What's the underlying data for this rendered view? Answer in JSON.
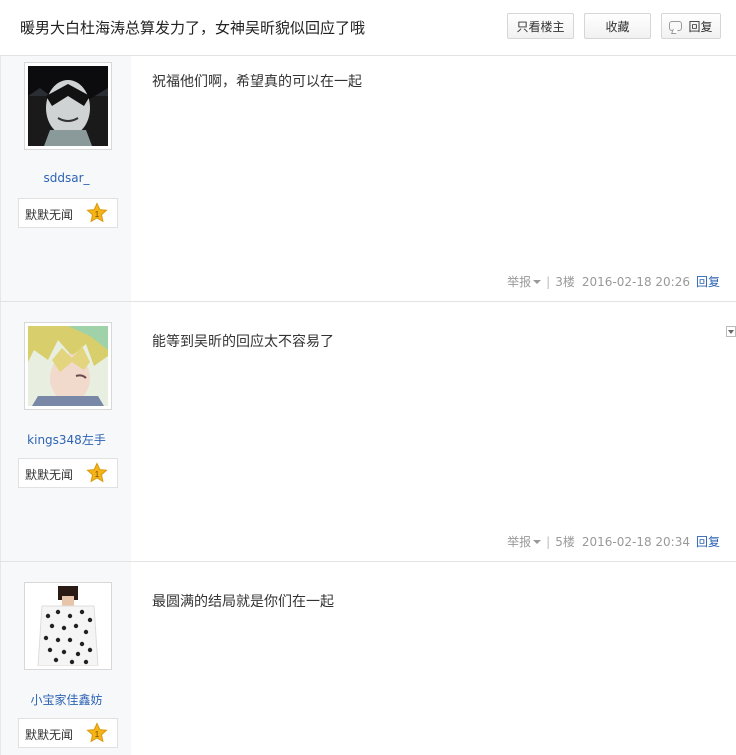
{
  "header": {
    "title": "暖男大白杜海涛总算发力了，女神吴昕貌似回应了哦",
    "only_op_label": "只看楼主",
    "favorite_label": "收藏",
    "reply_label": "回复",
    "reply_icon": "speech-bubble-icon"
  },
  "colors": {
    "link": "#2d64b3",
    "sidebar_bg": "#f7f8fa",
    "star": "#f5b418"
  },
  "posts": [
    {
      "username": "sddsar_",
      "avatar": "dark-haired-anime-avatar",
      "level_title": "默默无闻",
      "level_num": "1",
      "content": "祝福他们啊，希望真的可以在一起",
      "report_label": "举报",
      "separator": "|",
      "floor": "3楼",
      "time": "2016-02-18 20:26",
      "reply_label": "回复"
    },
    {
      "username": "kings348左手",
      "avatar": "blonde-anime-boy-avatar",
      "level_title": "默默无闻",
      "level_num": "1",
      "content": "能等到吴昕的回应太不容易了",
      "report_label": "举报",
      "separator": "|",
      "floor": "5楼",
      "time": "2016-02-18 20:34",
      "reply_label": "回复"
    },
    {
      "username": "小宝家佳鑫妨",
      "avatar": "polka-dot-dress-avatar",
      "level_title": "默默无闻",
      "level_num": "1",
      "content": "最圆满的结局就是你们在一起"
    }
  ]
}
